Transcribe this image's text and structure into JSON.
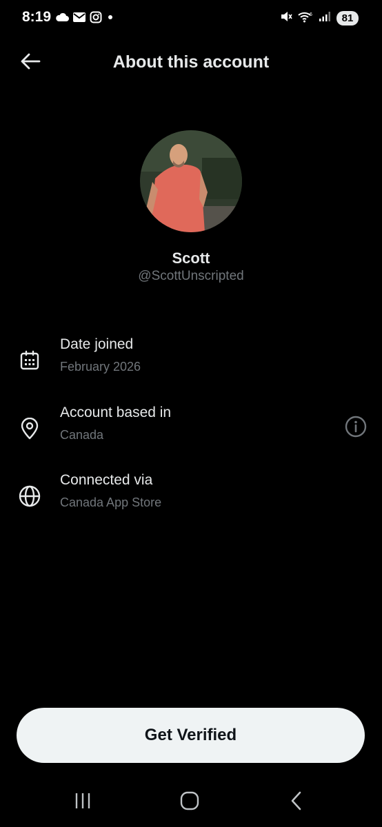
{
  "status_bar": {
    "time": "8:19",
    "battery": "81",
    "left_icons": [
      "cloud-icon",
      "mail-icon",
      "instagram-icon",
      "dot-icon"
    ],
    "right_icons": [
      "mute-icon",
      "wifi-icon",
      "signal-icon",
      "battery-icon"
    ]
  },
  "header": {
    "title": "About this account",
    "back_icon": "arrow-left-icon"
  },
  "profile": {
    "name": "Scott",
    "handle": "@ScottUnscripted"
  },
  "info": {
    "date_joined": {
      "title": "Date joined",
      "value": "February 2026",
      "icon": "calendar-icon"
    },
    "based_in": {
      "title": "Account based in",
      "value": "Canada",
      "icon": "location-pin-icon",
      "extra_icon": "info-icon"
    },
    "connected_via": {
      "title": "Connected via",
      "value": "Canada App Store",
      "icon": "globe-icon"
    }
  },
  "actions": {
    "verify_label": "Get Verified"
  },
  "nav": {
    "recents_icon": "recents-icon",
    "home_icon": "home-icon",
    "back_icon": "back-icon"
  },
  "colors": {
    "background": "#000000",
    "primary_text": "#e7e9ea",
    "secondary_text": "#71767b",
    "button_bg": "#eff3f4",
    "button_text": "#0f1419"
  }
}
